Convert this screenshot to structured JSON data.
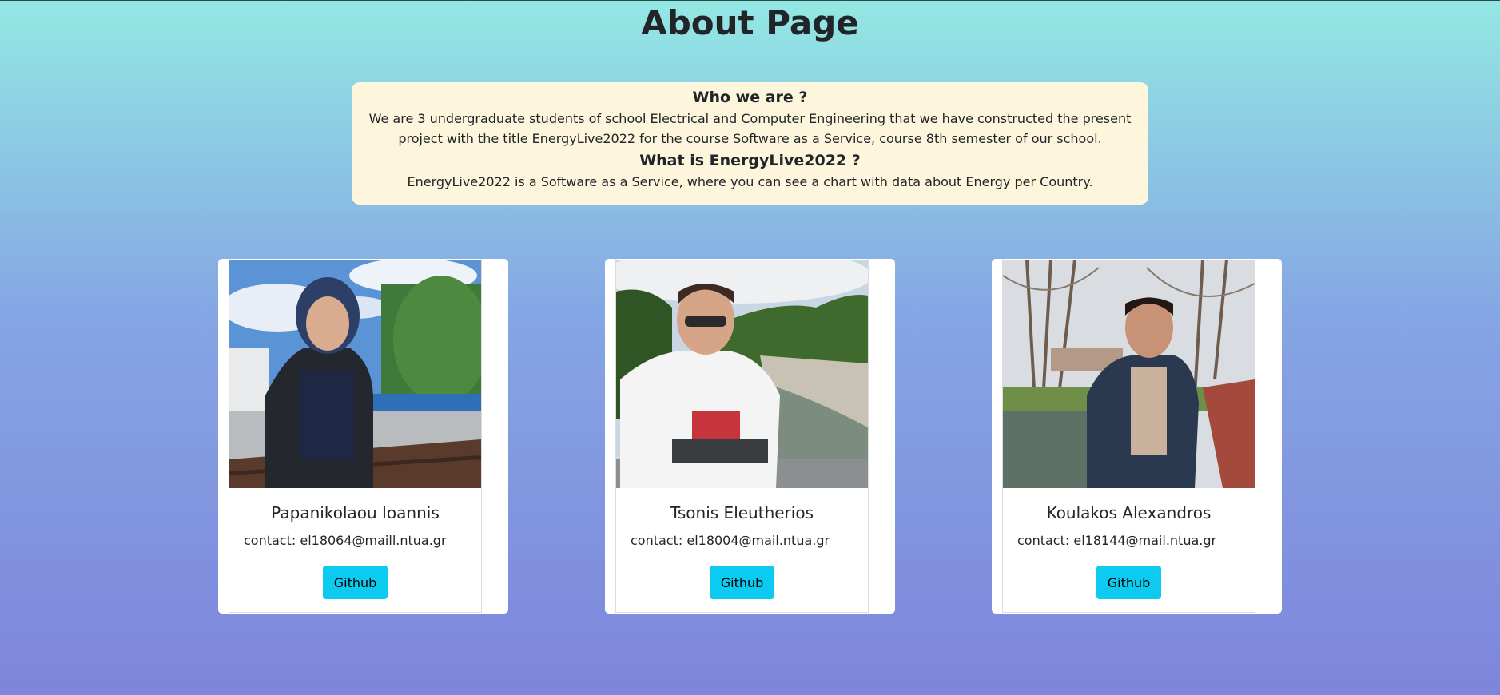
{
  "page": {
    "title": "About Page"
  },
  "info": {
    "who_heading": "Who we are ?",
    "who_text": "We are 3 undergraduate students of school Electrical and Computer Engineering that we have constructed the present project with the title EnergyLive2022 for the course Software as a Service, course 8th semester of our school.",
    "what_heading": "What is EnergyLive2022 ?",
    "what_text": "EnergyLive2022 is a Software as a Service, where you can see a chart with data about Energy per Country."
  },
  "team": [
    {
      "name": "Papanikolaou Ioannis",
      "contact": "contact: el18064@maill.ntua.gr",
      "button_label": "Github"
    },
    {
      "name": "Tsonis Eleutherios",
      "contact": "contact: el18004@mail.ntua.gr",
      "button_label": "Github"
    },
    {
      "name": "Koulakos Alexandros",
      "contact": "contact: el18144@mail.ntua.gr",
      "button_label": "Github"
    }
  ],
  "colors": {
    "background_top": "#93e8e3",
    "background_bottom": "#7e85dc",
    "info_box": "#fdf6dc",
    "button": "#0dcaf0"
  }
}
